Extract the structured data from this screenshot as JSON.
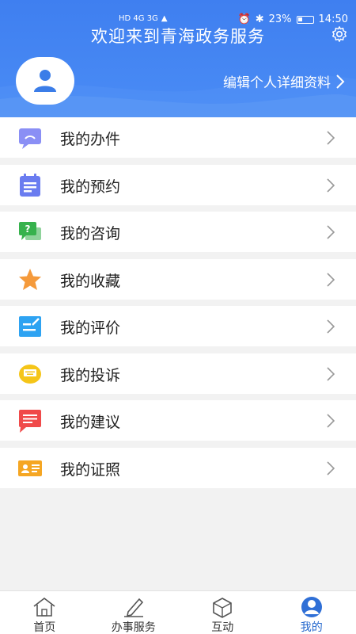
{
  "status_bar": {
    "left_icons": "HD 4G 3G",
    "battery": "23%",
    "time": "14:50"
  },
  "header": {
    "title": "欢迎来到青海政务服务",
    "edit_profile": "编辑个人详细资料"
  },
  "menu": [
    {
      "label": "我的办件",
      "icon": "chat-bubble-icon",
      "color": "#8a8ff5"
    },
    {
      "label": "我的预约",
      "icon": "notepad-icon",
      "color": "#6a7cf0"
    },
    {
      "label": "我的咨询",
      "icon": "question-chat-icon",
      "color": "#37b24d"
    },
    {
      "label": "我的收藏",
      "icon": "star-icon",
      "color": "#f59a3b"
    },
    {
      "label": "我的评价",
      "icon": "edit-note-icon",
      "color": "#2ea3f2"
    },
    {
      "label": "我的投诉",
      "icon": "complaint-icon",
      "color": "#f5c518"
    },
    {
      "label": "我的建议",
      "icon": "suggestion-icon",
      "color": "#f04a4a"
    },
    {
      "label": "我的证照",
      "icon": "id-card-icon",
      "color": "#f5a623"
    }
  ],
  "tabs": [
    {
      "label": "首页",
      "icon": "home-icon"
    },
    {
      "label": "办事服务",
      "icon": "pen-icon"
    },
    {
      "label": "互动",
      "icon": "cube-icon"
    },
    {
      "label": "我的",
      "icon": "profile-icon",
      "active": true
    }
  ]
}
